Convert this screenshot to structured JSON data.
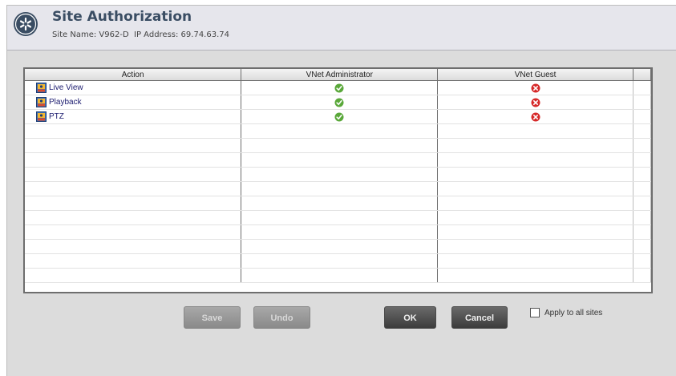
{
  "header": {
    "title": "Site Authorization",
    "subtitle": "Site Name: V962-D  IP Address: 69.74.63.74"
  },
  "table": {
    "columns": [
      "Action",
      "VNet Administrator",
      "VNet Guest"
    ],
    "rows": [
      {
        "action": "Live View",
        "admin": "allowed",
        "guest": "denied"
      },
      {
        "action": "Playback",
        "admin": "allowed",
        "guest": "denied"
      },
      {
        "action": "PTZ",
        "admin": "allowed",
        "guest": "denied"
      }
    ],
    "empty_rows": 11
  },
  "buttons": {
    "save": "Save",
    "undo": "Undo",
    "ok": "OK",
    "cancel": "Cancel"
  },
  "apply_all": {
    "label": "Apply to all sites",
    "checked": false
  },
  "colors": {
    "allowed": "#5aa83a",
    "denied": "#d62a2a",
    "title": "#3a4d63"
  }
}
